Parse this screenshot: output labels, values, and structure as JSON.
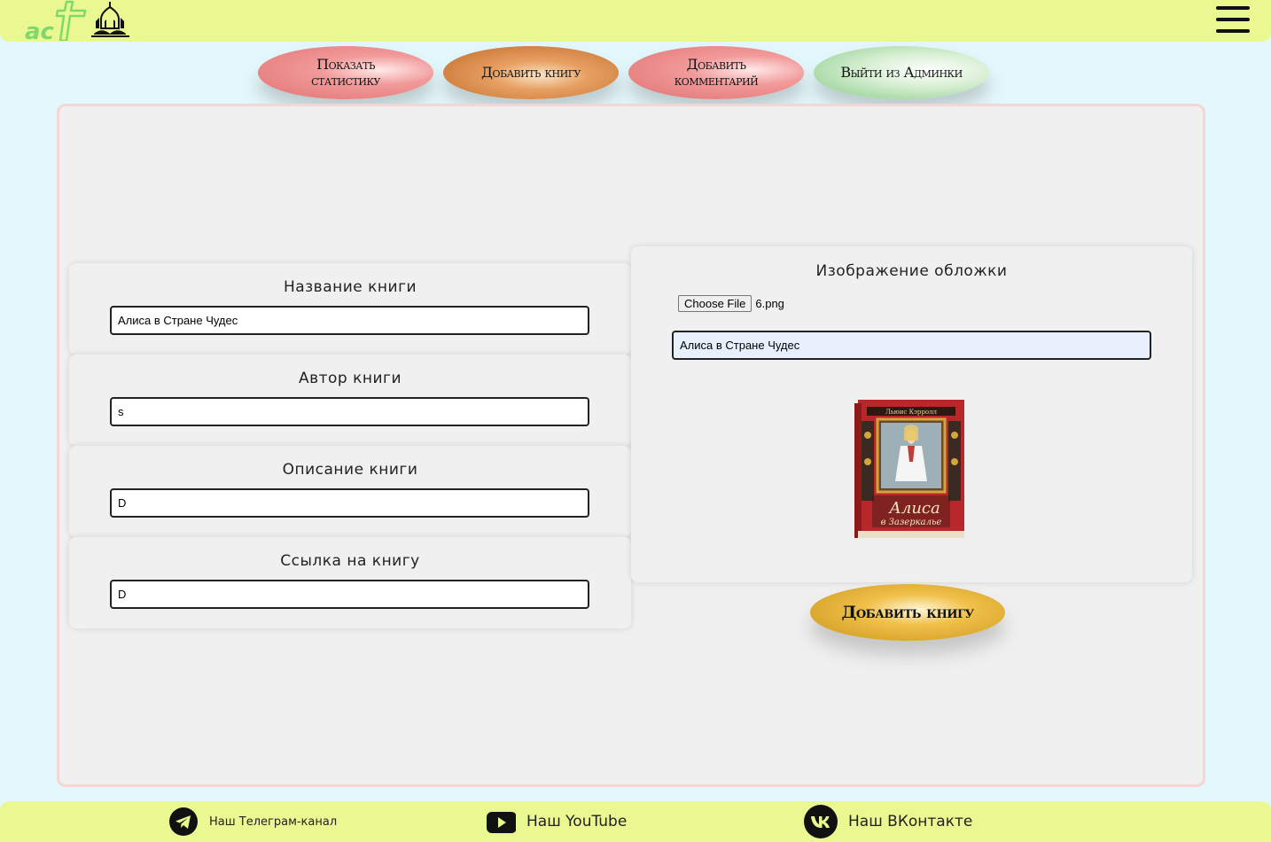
{
  "header": {
    "logo_text": "ac"
  },
  "nav": {
    "stats_label_1": "Показать",
    "stats_label_2": "статистику",
    "addbook_label": "Добавить книгу",
    "comment_label_1": "Добавить",
    "comment_label_2": "комментарий",
    "exit_label": "Выйти из Админки"
  },
  "form": {
    "title": {
      "label": "Название книги",
      "value": "Алиса в Стране Чудес"
    },
    "author": {
      "label": "Автор книги",
      "value": "s"
    },
    "description": {
      "label": "Описание книги",
      "value": "D"
    },
    "link": {
      "label": "Ссылка на книгу",
      "value": "D"
    },
    "cover": {
      "label": "Изображение обложки",
      "choose_file_label": "Choose File",
      "file_name": "6.png",
      "value": "Алиса в Стране Чудес"
    },
    "book_cover_text": {
      "author": "Льюис Кэрролл",
      "title": "Алиса",
      "subtitle": "в Зазеркалье"
    },
    "submit_label": "Добавить книгу"
  },
  "footer": {
    "telegram_label": "Наш Телеграм-канал",
    "youtube_label": "Наш YouTube",
    "vk_label": "Наш ВКонтакте"
  },
  "colors": {
    "header_bg": "#eaf892",
    "page_bg": "#e3f8fc",
    "logo_green": "#7fd96a"
  }
}
